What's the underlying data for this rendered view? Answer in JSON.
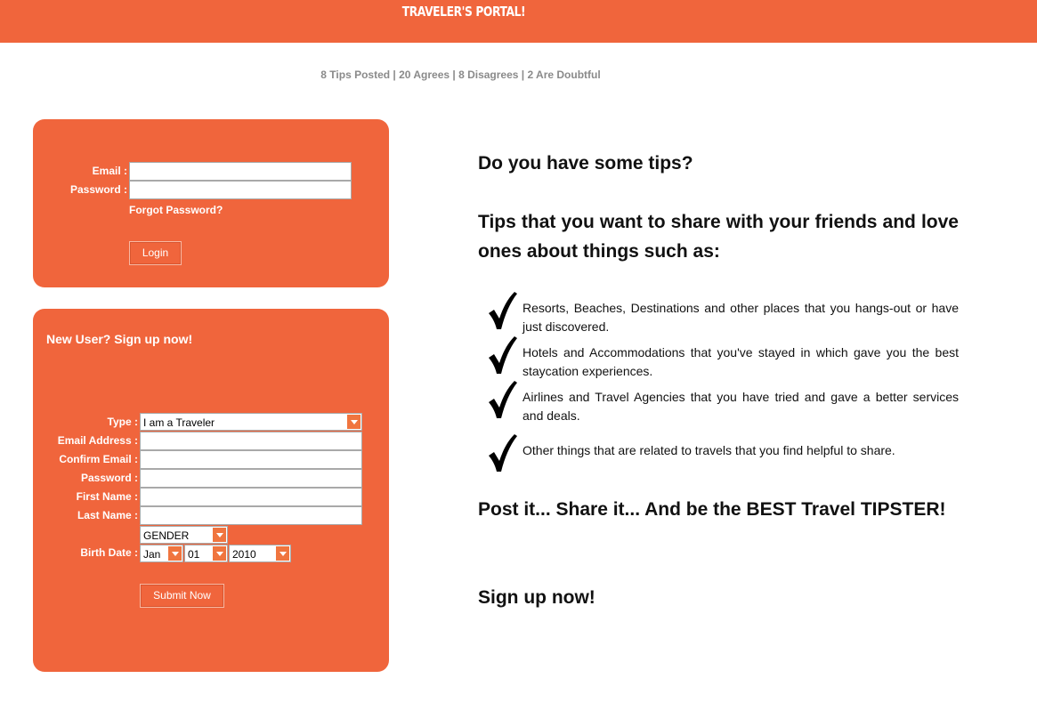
{
  "header": {
    "title": "TRAVELER'S PORTAL!",
    "bg_color": "#f0653c"
  },
  "stats": "8 Tips Posted | 20 Agrees | 8 Disagrees | 2 Are Doubtful",
  "login": {
    "email_label": "Email :",
    "password_label": "Password :",
    "email_value": "",
    "password_value": "",
    "forgot_link": "Forgot Password?",
    "login_button": "Login"
  },
  "signup": {
    "heading": "New User? Sign up now!",
    "type_label": "Type :",
    "type_value": "I am a Traveler",
    "email_label": "Email Address :",
    "confirm_email_label": "Confirm Email :",
    "password_label": "Password :",
    "first_name_label": "First Name :",
    "last_name_label": "Last Name :",
    "gender_value": "GENDER",
    "birth_date_label": "Birth Date :",
    "birth_month": "Jan",
    "birth_day": "01",
    "birth_year": "2010",
    "submit_button": "Submit Now"
  },
  "content": {
    "question": "Do you have some tips?",
    "intro": "Tips that you want to share with your friends and love ones about things such as:",
    "tips": [
      "Resorts, Beaches, Destinations and other places that you hangs-out or have just discovered.",
      "Hotels and Accommodations that you've stayed in which gave you the best staycation experiences.",
      "Airlines and Travel Agencies that you have tried and gave a better services and deals.",
      "Other things that are related to travels that you find helpful to share."
    ],
    "tagline": "Post it... Share it... And be the BEST Travel TIPSTER!",
    "cta": "Sign up now!"
  }
}
